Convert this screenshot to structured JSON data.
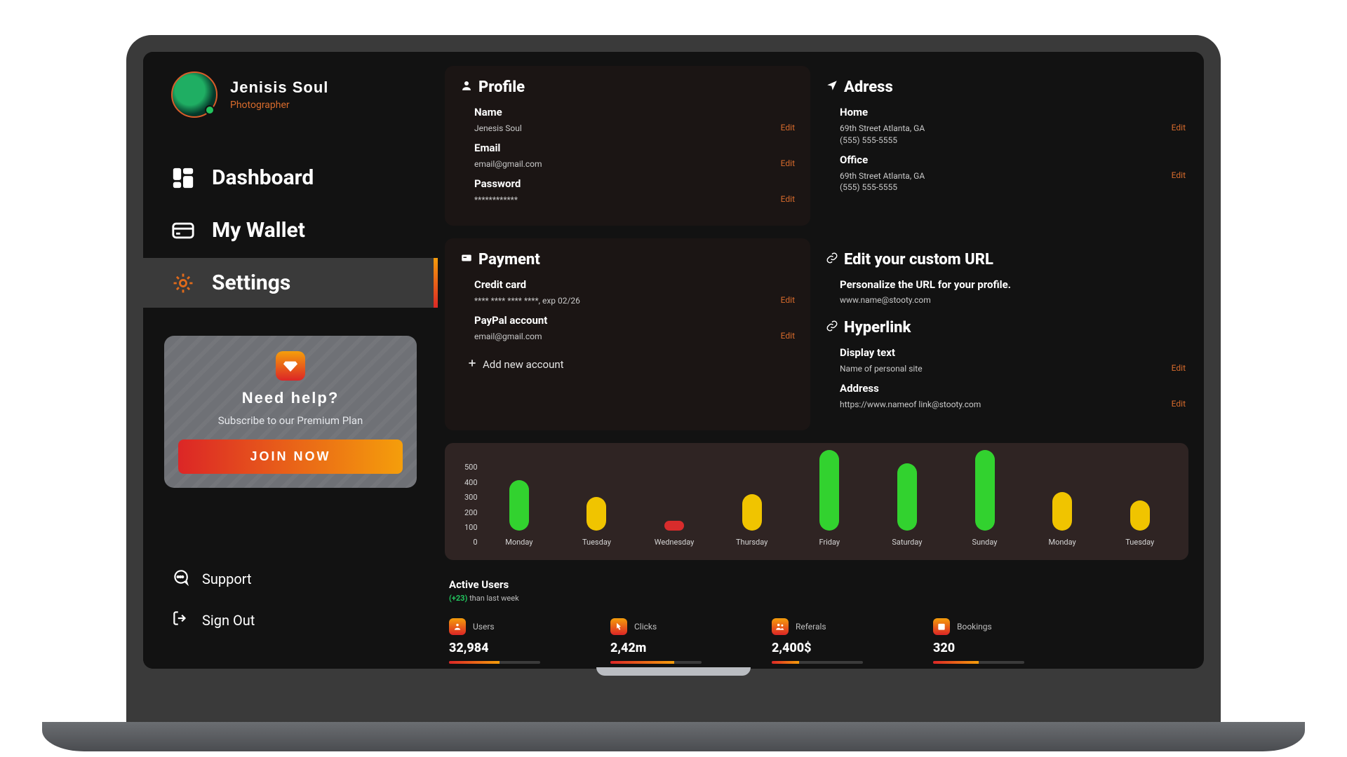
{
  "accent": "#d86b2c",
  "user": {
    "name": "Jenisis Soul",
    "role": "Photographer"
  },
  "sidebar": {
    "items": [
      {
        "key": "dashboard",
        "label": "Dashboard"
      },
      {
        "key": "wallet",
        "label": "My Wallet"
      },
      {
        "key": "settings",
        "label": "Settings"
      }
    ],
    "active": "settings",
    "footer": [
      {
        "key": "support",
        "label": "Support"
      },
      {
        "key": "signout",
        "label": "Sign Out"
      }
    ]
  },
  "promo": {
    "title": "Need help?",
    "subtitle": "Subscribe to our Premium Plan",
    "cta": "JOIN NOW"
  },
  "profile_card": {
    "title": "Profile",
    "fields": {
      "name": {
        "label": "Name",
        "value": "Jenesis Soul",
        "edit": "Edit"
      },
      "email": {
        "label": "Email",
        "value": "email@gmail.com",
        "edit": "Edit"
      },
      "password": {
        "label": "Password",
        "value": "************",
        "edit": "Edit"
      }
    }
  },
  "address_card": {
    "title": "Adress",
    "home": {
      "label": "Home",
      "line1": "69th Street Atlanta, GA",
      "line2": "(555) 555-5555",
      "edit": "Edit"
    },
    "office": {
      "label": "Office",
      "line1": "69th Street Atlanta, GA",
      "line2": "(555) 555-5555",
      "edit": "Edit"
    }
  },
  "payment_card": {
    "title": "Payment",
    "credit": {
      "label": "Credit card",
      "value": "**** **** **** ****, exp 02/26",
      "edit": "Edit"
    },
    "paypal": {
      "label": "PayPal account",
      "value": "email@gmail.com",
      "edit": "Edit"
    },
    "add": "Add new account"
  },
  "url_card": {
    "title": "Edit your custom URL",
    "subtitle": "Personalize the URL for your profile.",
    "value": "www.name@stooty.com",
    "hyper_title": "Hyperlink",
    "display": {
      "label": "Display text",
      "value": "Name of personal site",
      "edit": "Edit"
    },
    "address": {
      "label": "Address",
      "value": "https://www.nameof link@stooty.com",
      "edit": "Edit"
    }
  },
  "active_users": {
    "title": "Active Users",
    "delta": "(+23)",
    "sub": "than last week",
    "stats": [
      {
        "key": "users",
        "label": "Users",
        "value": "32,984",
        "progress": 55
      },
      {
        "key": "clicks",
        "label": "Clicks",
        "value": "2,42m",
        "progress": 70
      },
      {
        "key": "referals",
        "label": "Referals",
        "value": "2,400$",
        "progress": 30
      },
      {
        "key": "bookings",
        "label": "Bookings",
        "value": "320",
        "progress": 50
      }
    ]
  },
  "chart_data": {
    "type": "bar",
    "title": "",
    "xlabel": "",
    "ylabel": "",
    "ylim": [
      0,
      500
    ],
    "y_ticks": [
      500,
      400,
      300,
      200,
      100,
      0
    ],
    "categories": [
      "Monday",
      "Tuesday",
      "Wednesday",
      "Thursday",
      "Friday",
      "Saturday",
      "Sunday",
      "Monday",
      "Tuesday"
    ],
    "values": [
      300,
      200,
      60,
      220,
      480,
      400,
      480,
      230,
      180
    ],
    "colors": [
      "#32d22f",
      "#f0c400",
      "#d82c2c",
      "#f0c400",
      "#32d22f",
      "#32d22f",
      "#32d22f",
      "#f0c400",
      "#f0c400"
    ]
  }
}
